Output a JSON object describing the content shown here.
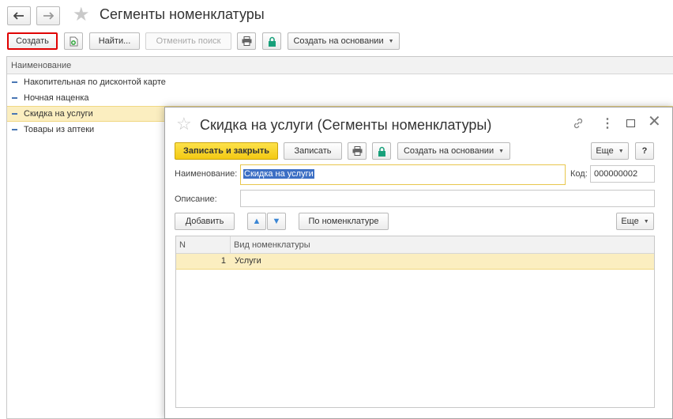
{
  "main": {
    "title": "Сегменты номенклатуры",
    "toolbar": {
      "create_label": "Создать",
      "find_label": "Найти...",
      "cancel_find_label": "Отменить поиск",
      "create_basis_label": "Создать на основании"
    },
    "list": {
      "column_header": "Наименование",
      "items": [
        {
          "label": "Накопительная по дисконтой карте"
        },
        {
          "label": "Ночная наценка"
        },
        {
          "label": "Скидка на услуги"
        },
        {
          "label": "Товары из аптеки"
        }
      ],
      "selected_index": 2
    }
  },
  "dialog": {
    "title": "Скидка на услуги (Сегменты номенклатуры)",
    "toolbar": {
      "save_close_label": "Записать и закрыть",
      "save_label": "Записать",
      "create_basis_label": "Создать на основании",
      "more_label": "Еще",
      "help_label": "?"
    },
    "form": {
      "name_label": "Наименование:",
      "name_value": "Скидка на услуги",
      "code_label": "Код:",
      "code_value": "000000002",
      "description_label": "Описание:",
      "description_value": ""
    },
    "table_toolbar": {
      "add_label": "Добавить",
      "by_nomenclature_label": "По номенклатуре",
      "more_label": "Еще"
    },
    "table": {
      "columns": [
        "N",
        "Вид номенклатуры"
      ],
      "rows": [
        {
          "n": "1",
          "kind": "Услуги"
        }
      ]
    }
  },
  "colors": {
    "accent_yellow": "#f5d02a",
    "selection": "#fbeec0",
    "highlight_red": "#e00000",
    "text_selection": "#3c6fc4"
  },
  "icons": [
    "back-arrow-icon",
    "forward-arrow-icon",
    "star-icon",
    "copy-add-icon",
    "print-icon",
    "lock-icon",
    "link-icon",
    "more-icon",
    "maximize-icon",
    "close-icon",
    "arrow-up-icon",
    "arrow-down-icon"
  ]
}
